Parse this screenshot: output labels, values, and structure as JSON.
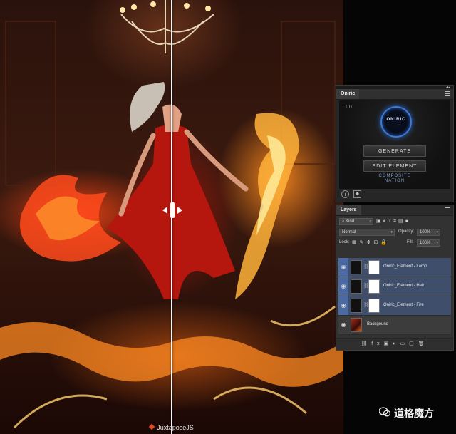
{
  "artwork": {
    "credit_text": "JuxtaposeJS"
  },
  "oniric_panel": {
    "tab_label": "Oniric",
    "version": "1.0",
    "logo_text": "ONIRIC",
    "generate_label": "GENERATE",
    "edit_element_label": "EDIT ELEMENT",
    "brand_line1": "COMPOSITE",
    "brand_line2": "NATION",
    "info_icon": "info-icon",
    "mascot_icon": "mascot-icon"
  },
  "layers_panel": {
    "tab_label": "Layers",
    "filter_kind": "Kind",
    "blend_mode": "Normal",
    "opacity_label": "Opacity:",
    "opacity_value": "100%",
    "lock_label": "Lock:",
    "fill_label": "Fill:",
    "fill_value": "100%",
    "layers": [
      {
        "name": "Oniric_Element - Lamp",
        "selected": true,
        "has_mask": true
      },
      {
        "name": "Oniric_Element - Hair",
        "selected": true,
        "has_mask": true
      },
      {
        "name": "Oniric_Element - Fire",
        "selected": true,
        "has_mask": true
      },
      {
        "name": "Backgound",
        "selected": false,
        "has_mask": false
      }
    ]
  },
  "watermark": {
    "text": "道格魔方"
  }
}
